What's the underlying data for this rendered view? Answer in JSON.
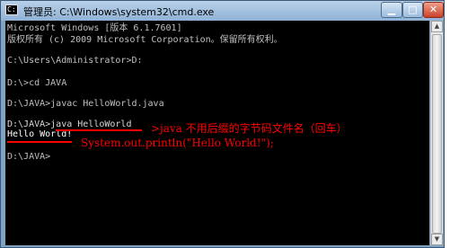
{
  "window": {
    "title": "管理员: C:\\Windows\\system32\\cmd.exe",
    "icon": "cmd-icon",
    "controls": {
      "minimize": "minimize-icon",
      "maximize": "maximize-icon",
      "close": "close-icon"
    }
  },
  "console": {
    "lines": [
      "Microsoft Windows [版本 6.1.7601]",
      "版权所有 (c) 2009 Microsoft Corporation。保留所有权利。",
      "",
      "C:\\Users\\Administrator>D:",
      "",
      "D:\\>cd JAVA",
      "",
      "D:\\JAVA>javac HelloWorld.java",
      "",
      "D:\\JAVA>java HelloWorld",
      "Hello World!",
      "",
      "D:\\JAVA>"
    ]
  },
  "annotations": {
    "command_note": ">java 不用后缀的字节码文件名（回车）",
    "output_note": "System.out.println(\"Hello World!\");"
  },
  "colors": {
    "annotation": "#ff0000",
    "console_text": "#c0c0c0",
    "console_bg": "#000000"
  }
}
